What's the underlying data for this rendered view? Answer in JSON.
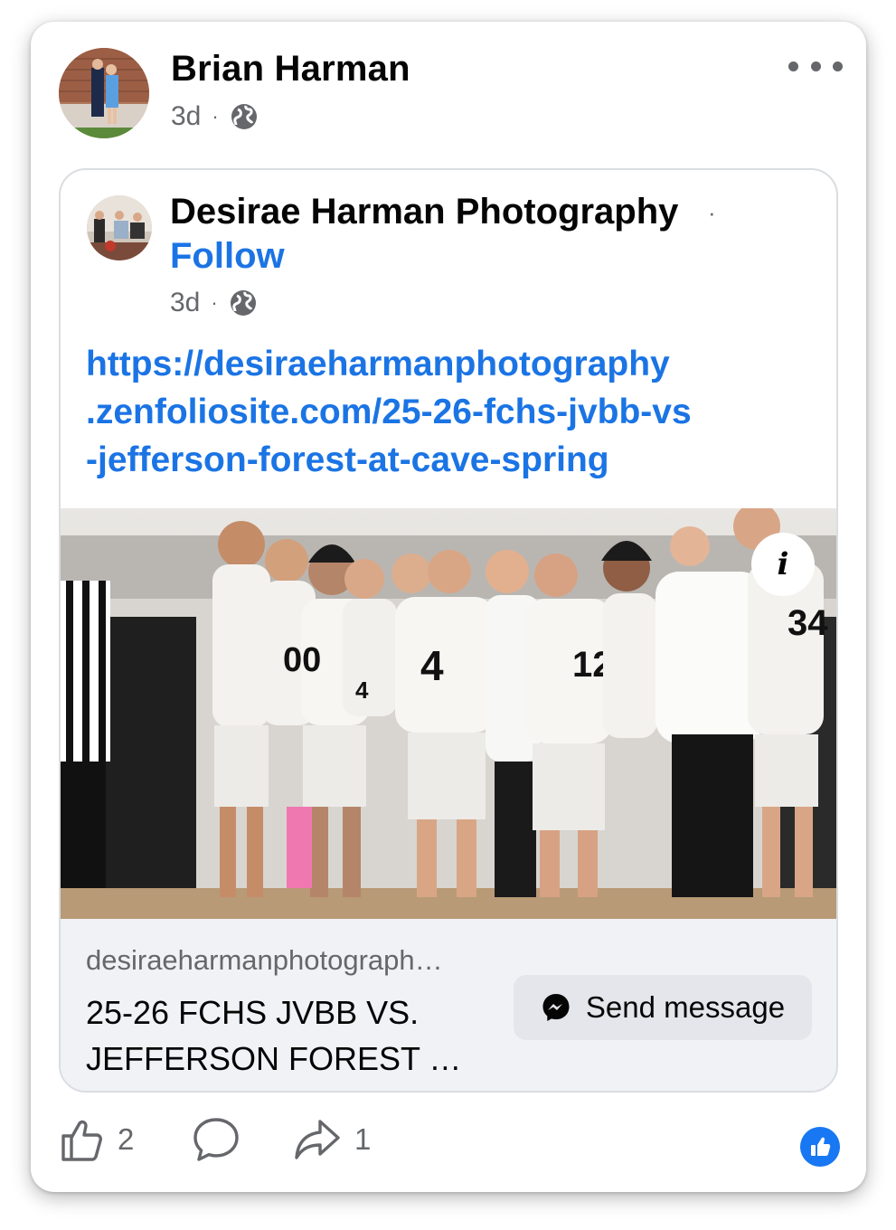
{
  "post": {
    "author": "Brian Harman",
    "time": "3d",
    "separator": "·",
    "audience_icon": "globe-icon",
    "more_icon": "more-horizontal-icon"
  },
  "shared_post": {
    "page_name": "Desirae Harman Photography",
    "separator": "·",
    "follow_label": "Follow",
    "time": "3d",
    "audience_icon": "globe-icon",
    "url_lines": [
      "https://desiraeharmanphotography",
      ".zenfoliosite.com/25-26-fchs-jvbb-vs",
      "-jefferson-forest-at-cave-spring"
    ],
    "photo": {
      "description_icon": "info-icon",
      "jersey_numbers": [
        "00",
        "4",
        "4",
        "12",
        "34"
      ]
    },
    "link_preview": {
      "domain": "desiraeharmanphotograph…",
      "title_lines": [
        "25-26 FCHS JVBB VS.",
        "JEFFERSON FOREST …"
      ],
      "send_message_label": "Send message",
      "send_icon": "messenger-icon"
    }
  },
  "actions": {
    "like_count": "2",
    "share_count": "1",
    "like_icon": "thumbs-up-icon",
    "comment_icon": "comment-icon",
    "share_icon": "share-icon",
    "reaction_icon": "like-reaction-icon"
  },
  "colors": {
    "link_blue": "#1b74e4",
    "reaction_blue": "#1877f2",
    "secondary_text": "#65676b",
    "preview_bg": "#f0f2f5"
  }
}
